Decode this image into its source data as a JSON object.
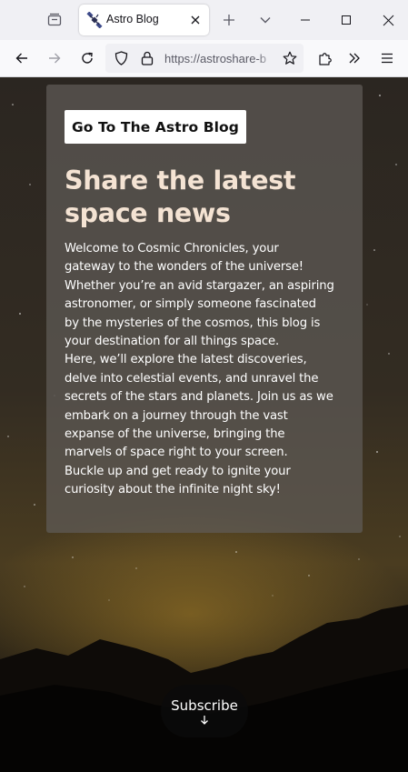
{
  "browser": {
    "tab": {
      "title": "Astro Blog"
    },
    "url": "https://astroshare-b"
  },
  "page": {
    "blog_button_label": "Go To The Astro Blog",
    "headline_lines": [
      "Share the latest",
      "space news"
    ],
    "body_lines": [
      "Welcome to Cosmic Chronicles, your",
      "gateway to the wonders of the universe!",
      "Whether you’re an avid stargazer, an aspiring",
      "astronomer, or simply someone fascinated",
      "by the mysteries of the cosmos, this blog is",
      "your destination for all things space.",
      "Here, we’ll explore the latest discoveries,",
      "delve into celestial events, and unravel the",
      "secrets of the stars and planets. Join us as we",
      "embark on a journey through the vast",
      "expanse of the universe, bringing the",
      "marvels of space right to your screen.",
      "Buckle up and get ready to ignite your",
      "curiosity about the infinite night sky!"
    ],
    "subscribe_label": "Subscribe"
  },
  "icons": {
    "favicon": "satellite-icon",
    "arrow": "arrow-down-icon"
  }
}
